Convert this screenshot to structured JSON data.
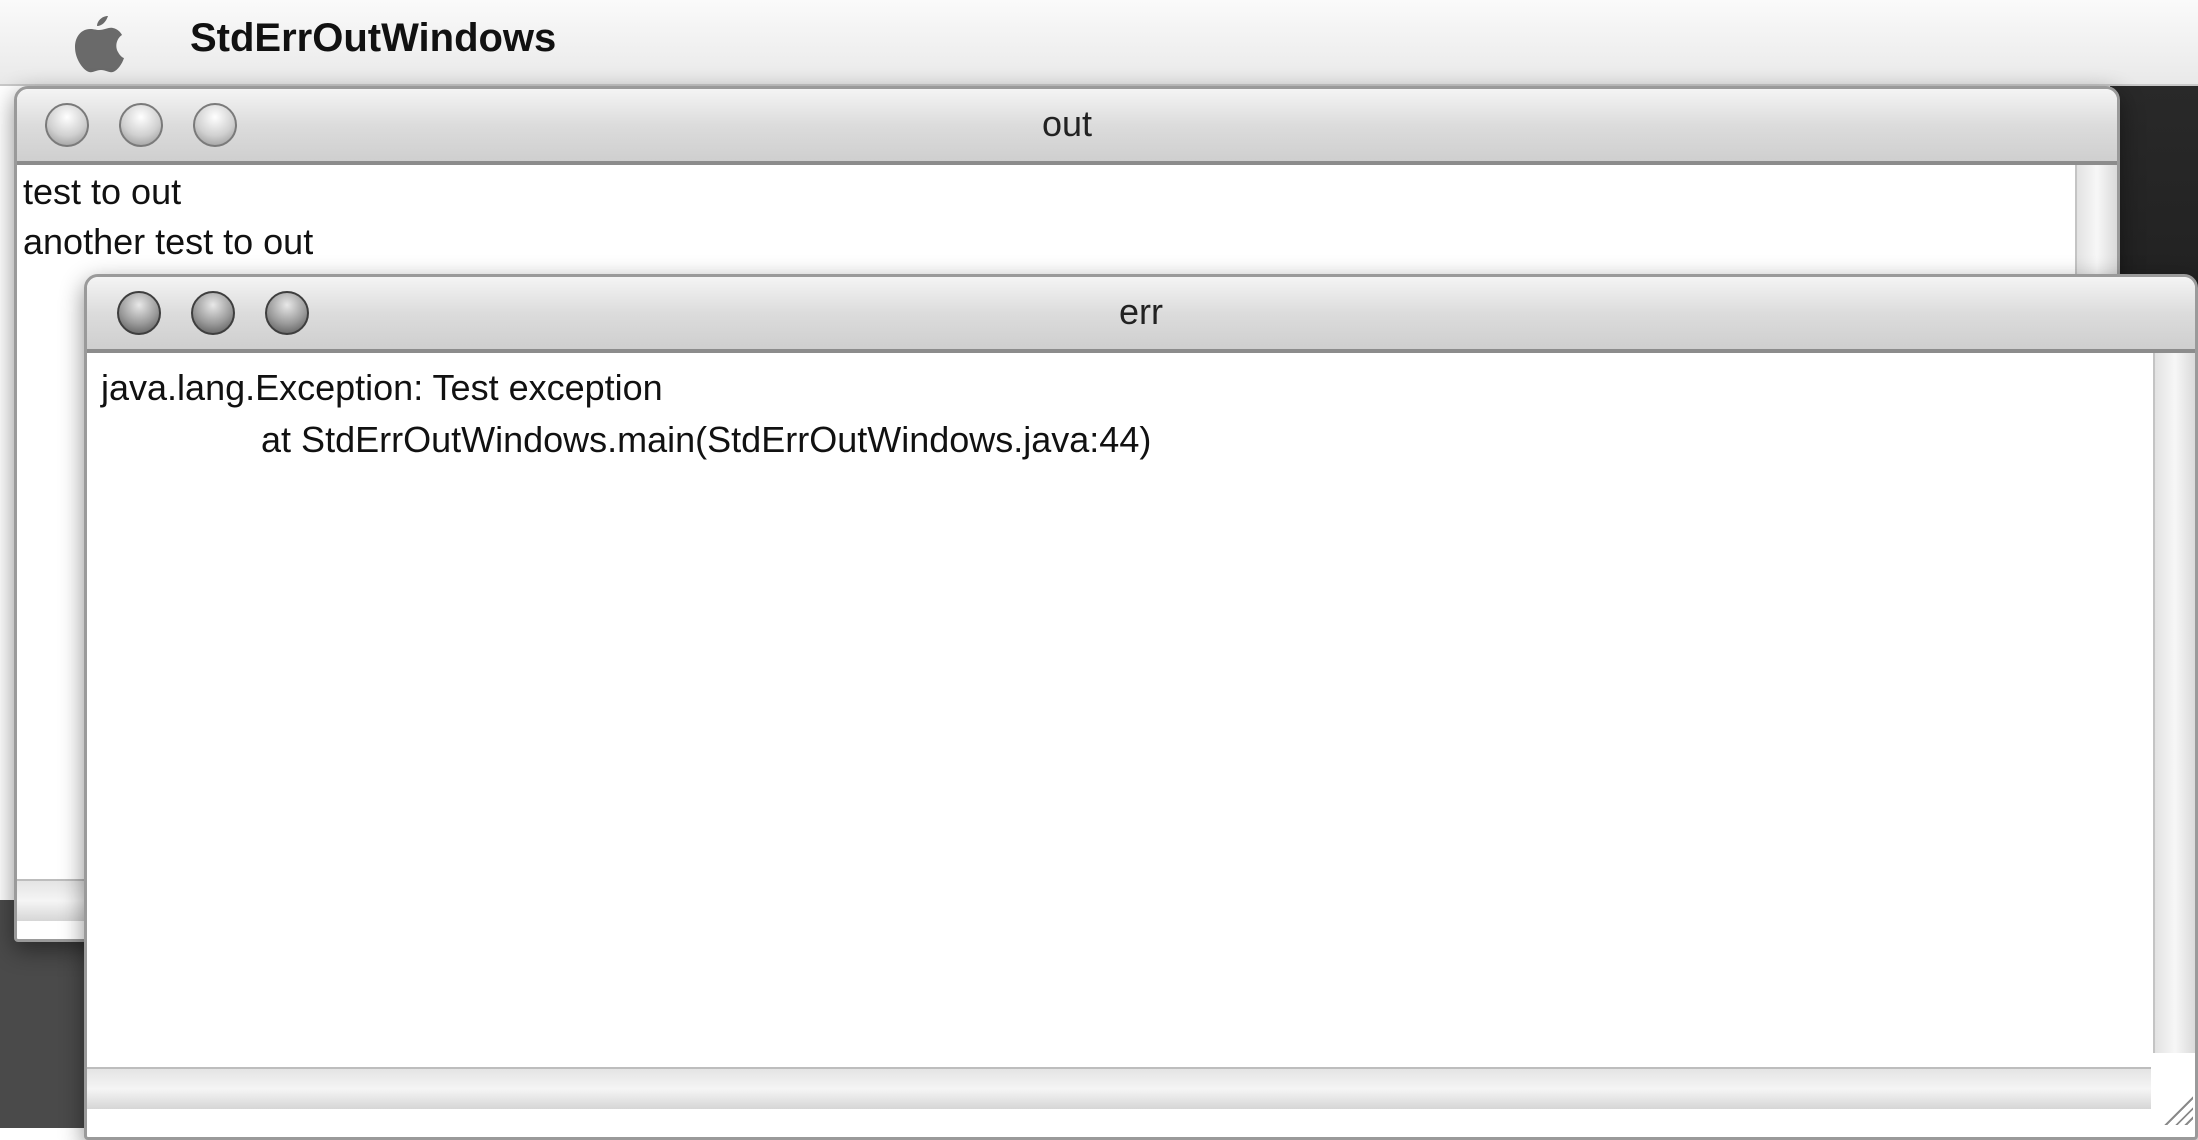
{
  "menubar": {
    "app_name": "StdErrOutWindows",
    "apple_icon": "apple-icon"
  },
  "out_window": {
    "title": "out",
    "lines": [
      "test to out",
      "another test to out"
    ]
  },
  "err_window": {
    "title": "err",
    "lines": [
      "java.lang.Exception: Test exception",
      "                at StdErrOutWindows.main(StdErrOutWindows.java:44)"
    ]
  },
  "colors": {
    "menubar": "#eeeeee",
    "titlebar": "#d8d8d8",
    "content": "#ffffff",
    "text": "#111111"
  }
}
